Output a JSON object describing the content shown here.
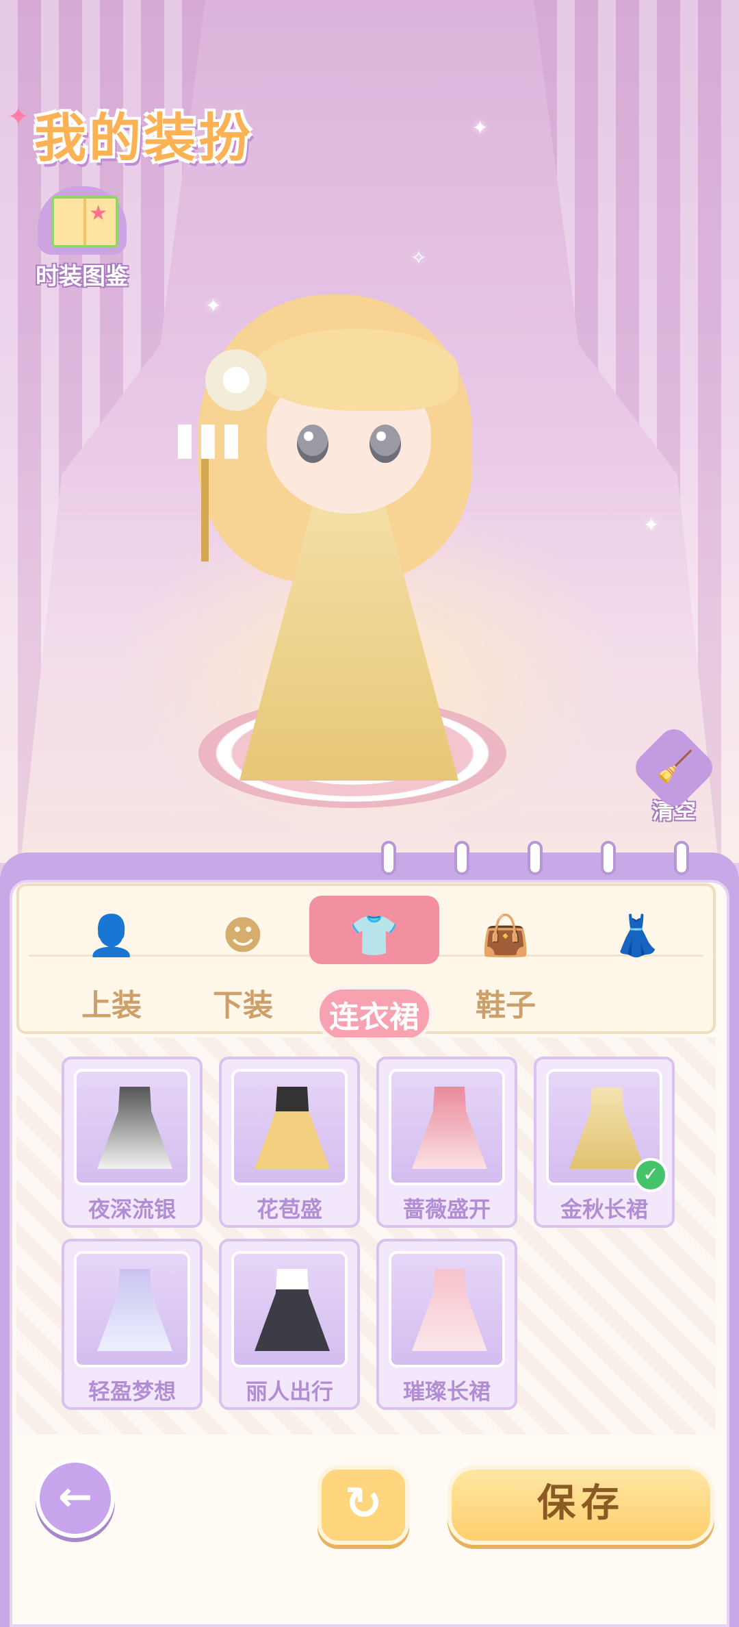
{
  "header": {
    "title": "我的装扮"
  },
  "catalog": {
    "label": "时装图鉴"
  },
  "clear": {
    "label": "清空"
  },
  "tabs": [
    {
      "icon": "top-icon",
      "label": "上装",
      "active": false
    },
    {
      "icon": "bottom-icon",
      "label": "下装",
      "active": false
    },
    {
      "icon": "dress-shirt-icon",
      "label": "连衣裙",
      "active": true
    },
    {
      "icon": "bag-icon",
      "label": "鞋子",
      "active": false
    },
    {
      "icon": "accessory-icon",
      "label": "",
      "active": false
    }
  ],
  "items": [
    {
      "name": "夜深流银",
      "selected": false
    },
    {
      "name": "花苞盛",
      "selected": false
    },
    {
      "name": "蔷薇盛开",
      "selected": false
    },
    {
      "name": "金秋长裙",
      "selected": true
    },
    {
      "name": "轻盈梦想",
      "selected": false
    },
    {
      "name": "丽人出行",
      "selected": false
    },
    {
      "name": "璀璨长裙",
      "selected": false
    }
  ],
  "buttons": {
    "save": "保存"
  },
  "colors": {
    "accent": "#f28fa0",
    "panel": "#c8a8e6",
    "tab_text": "#cda06a",
    "card_text": "#b18ed3",
    "check": "#44c36b"
  }
}
